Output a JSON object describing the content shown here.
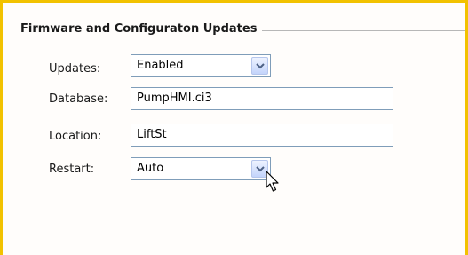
{
  "section": {
    "title": "Firmware and Configuraton Updates"
  },
  "fields": {
    "updates": {
      "label": "Updates:",
      "value": "Enabled"
    },
    "database": {
      "label": "Database:",
      "value": "PumpHMI.ci3"
    },
    "location": {
      "label": "Location:",
      "value": "LiftSt"
    },
    "restart": {
      "label": "Restart:",
      "value": "Auto"
    }
  },
  "icons": {
    "dropdown": "chevron-down-icon",
    "cursor": "mouse-pointer-icon"
  },
  "colors": {
    "frame": "#f2c200",
    "field_border": "#7f9db9",
    "dropdown_button": "#c3d4fb",
    "chevron": "#4d6185"
  }
}
